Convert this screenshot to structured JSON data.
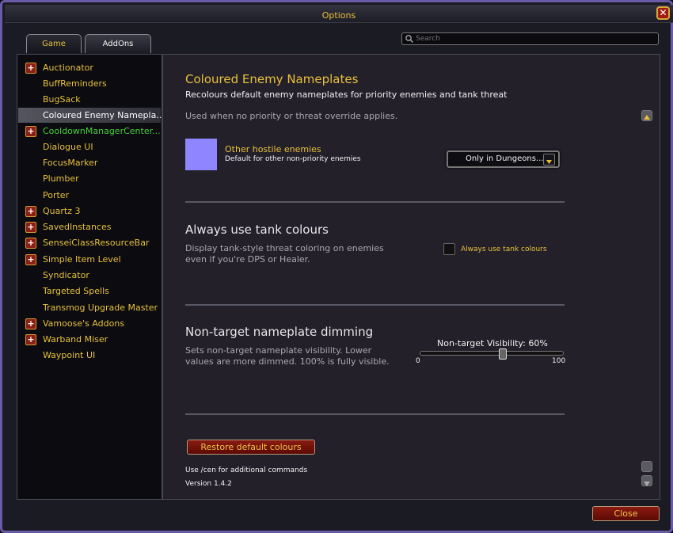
{
  "window": {
    "title": "Options",
    "close_icon": "close-icon"
  },
  "tabs": [
    {
      "label": "Game"
    },
    {
      "label": "AddOns"
    }
  ],
  "search": {
    "placeholder": "Search"
  },
  "sidebar": {
    "items": [
      {
        "label": "Auctionator",
        "expandable": true
      },
      {
        "label": "BuffReminders",
        "expandable": false
      },
      {
        "label": "BugSack",
        "expandable": false
      },
      {
        "label": "Coloured Enemy Nameplа...",
        "expandable": false,
        "selected": true
      },
      {
        "label": "CooldownManagerCenter...",
        "expandable": true,
        "color": "#48d13a"
      },
      {
        "label": "Dialogue UI",
        "expandable": false
      },
      {
        "label": "FocusMarker",
        "expandable": false
      },
      {
        "label": "Plumber",
        "expandable": false
      },
      {
        "label": "Porter",
        "expandable": false
      },
      {
        "label": "Quartz 3",
        "expandable": true
      },
      {
        "label": "SavedInstances",
        "expandable": true
      },
      {
        "label": "SenseiClassResourceBar",
        "expandable": true
      },
      {
        "label": "Simple Item Level",
        "expandable": true
      },
      {
        "label": "Syndicator",
        "expandable": false
      },
      {
        "label": "Targeted Spells",
        "expandable": false
      },
      {
        "label": "Transmog Upgrade Master",
        "expandable": false
      },
      {
        "label": "Vamoose's Addons",
        "expandable": true
      },
      {
        "label": "Warband Miser",
        "expandable": true
      },
      {
        "label": "Waypoint UI",
        "expandable": false
      }
    ]
  },
  "main": {
    "title": "Coloured Enemy Nameplates",
    "subtitle": "Recolours default enemy nameplates for priority enemies and tank threat",
    "note": "Used when no priority or threat override applies.",
    "hostile": {
      "label": "Other hostile enemies",
      "desc": "Default for other non-priority enemies",
      "color": "#8f86ff"
    },
    "dropdown": {
      "value": "Only in Dungeons..."
    },
    "tank": {
      "heading": "Always use tank colours",
      "desc_line1": "Display tank-style threat coloring on enemies",
      "desc_line2": "even if you're DPS or Healer.",
      "checkbox_label": "Always use tank colours",
      "checked": false
    },
    "dimming": {
      "heading": "Non-target nameplate dimming",
      "desc_line1": "Sets non-target nameplate visibility. Lower",
      "desc_line2": "values are more dimmed. 100% is fully visible.",
      "slider_label": "Non-target Visibility: 60%",
      "slider_value": 60,
      "slider_min": "0",
      "slider_max": "100"
    },
    "restore_label": "Restore default colours",
    "footer_commands": "Use /cen for additional commands",
    "footer_version": "Version 1.4.2"
  },
  "close_button": {
    "label": "Close"
  },
  "colors": {
    "gold": "#e8c13c",
    "border": "#6a5aa8",
    "red_button": "#8a1b10"
  }
}
